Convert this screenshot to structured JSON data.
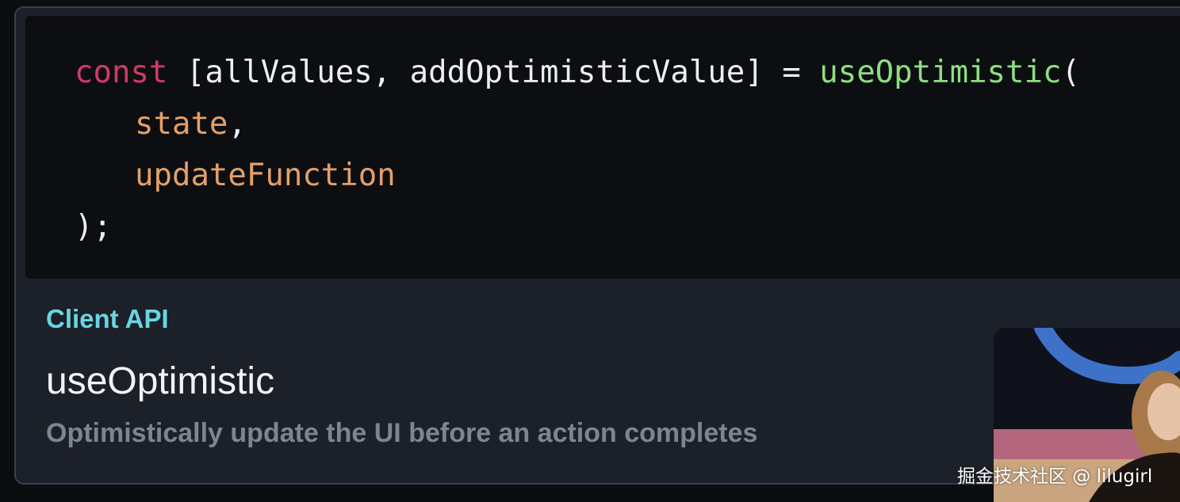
{
  "code": {
    "line1": {
      "keyword": "const",
      "destructure": "[allValues, addOptimisticValue]",
      "equals": "=",
      "function": "useOptimistic",
      "open_paren": "("
    },
    "line2": {
      "arg": "state",
      "comma": ","
    },
    "line3": {
      "arg": "updateFunction"
    },
    "line4": {
      "close": ");"
    }
  },
  "info": {
    "category": "Client API",
    "title": "useOptimistic",
    "description": "Optimistically update the UI before an action completes"
  },
  "watermark": "掘金技术社区 @ lilugirl",
  "colors": {
    "keyword": "#d23a66",
    "function": "#8de07f",
    "argument": "#e3a168",
    "category": "#69d6df",
    "code_background": "#0d0e12",
    "card_background": "#1c2028"
  }
}
